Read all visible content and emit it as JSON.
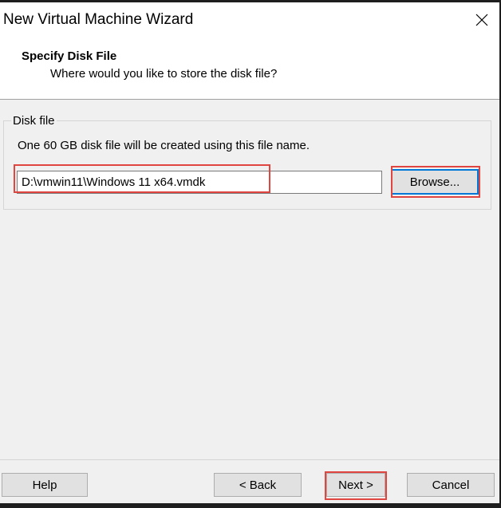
{
  "window": {
    "title": "New Virtual Machine Wizard"
  },
  "header": {
    "title": "Specify Disk File",
    "subtitle": "Where would you like to store the disk file?"
  },
  "disk_file_group": {
    "legend": "Disk file",
    "description": "One 60 GB disk file will be created using this file name.",
    "path_value": "D:\\vmwin11\\Windows 11 x64.vmdk",
    "browse_label": "Browse..."
  },
  "footer": {
    "help_label": "Help",
    "back_label": "< Back",
    "next_label": "Next >",
    "cancel_label": "Cancel"
  },
  "icons": {
    "close": "close-icon"
  },
  "colors": {
    "highlight": "#e0453f",
    "focus_border": "#0078d7",
    "dialog_bg": "#f0f0f0"
  }
}
